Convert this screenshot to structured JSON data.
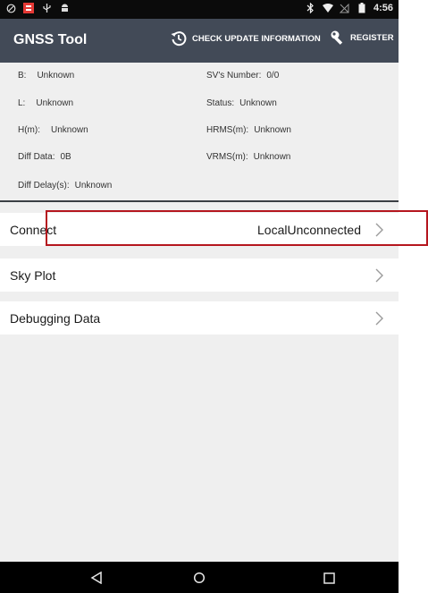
{
  "statusbar": {
    "left_icons": [
      "alarm-icon",
      "app-notification-icon",
      "usb-icon",
      "android-debug-icon"
    ],
    "right_icons": [
      "bluetooth-icon",
      "wifi-icon",
      "no-sim-icon",
      "battery-icon"
    ],
    "time": "4:56"
  },
  "appbar": {
    "title": "GNSS Tool",
    "check_update_label": "CHECK UPDATE INFORMATION",
    "register_label": "REGISTER",
    "background": "#424a57"
  },
  "info": {
    "b": {
      "label": "B:",
      "value": "Unknown"
    },
    "l": {
      "label": "L:",
      "value": "Unknown"
    },
    "h": {
      "label": "H(m):",
      "value": "Unknown"
    },
    "diff_data": {
      "label": "Diff Data:",
      "value": "0B"
    },
    "diff_delay": {
      "label": "Diff Delay(s):",
      "value": "Unknown"
    },
    "sv_number": {
      "label": "SV's Number:",
      "value": "0/0"
    },
    "status": {
      "label": "Status:",
      "value": "Unknown"
    },
    "hrms": {
      "label": "HRMS(m):",
      "value": "Unknown"
    },
    "vrms": {
      "label": "VRMS(m):",
      "value": "Unknown"
    }
  },
  "menu": {
    "connect": {
      "label": "Connect",
      "value": "LocalUnconnected"
    },
    "sky_plot": {
      "label": "Sky Plot"
    },
    "debugging": {
      "label": "Debugging Data"
    }
  },
  "highlight_color": "#b5161e",
  "navbar": {
    "icons": [
      "back-icon",
      "home-icon",
      "recents-icon"
    ]
  }
}
